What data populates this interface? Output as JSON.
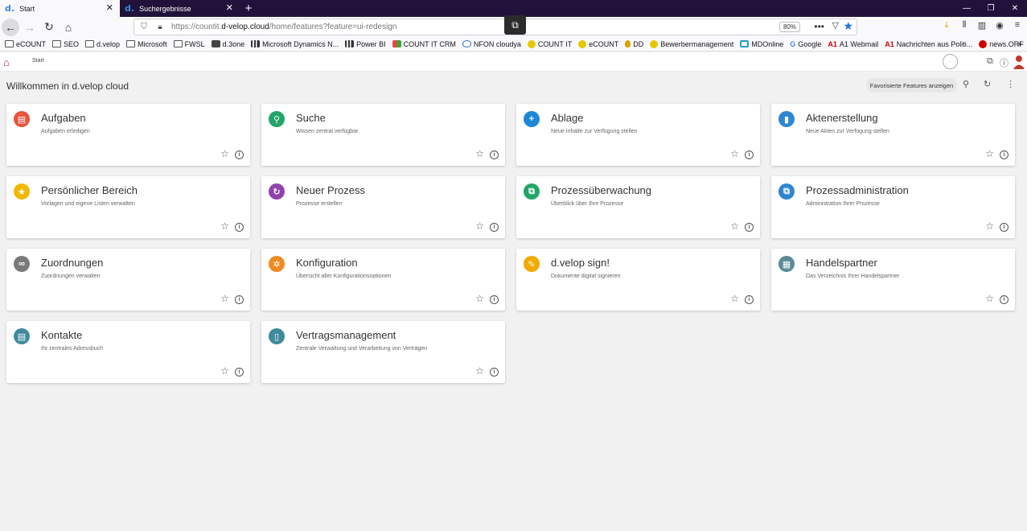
{
  "browser": {
    "tabs": [
      {
        "label": "Start",
        "favicon": "d."
      },
      {
        "label": "Suchergebnisse",
        "favicon": "d."
      }
    ],
    "url_prefix": "https://countit.",
    "url_domain": "d-velop.cloud",
    "url_path": "/home/features?feature=ui-redesign",
    "zoom": "80%"
  },
  "bookmarks": [
    {
      "label": "eCOUNT",
      "icon": "folder-icon"
    },
    {
      "label": "SEO",
      "icon": "folder-icon"
    },
    {
      "label": "d.velop",
      "icon": "folder-icon"
    },
    {
      "label": "Microsoft",
      "icon": "folder-icon"
    },
    {
      "label": "FWSL",
      "icon": "folder-icon"
    },
    {
      "label": "d.3one",
      "icon": "square-icon"
    },
    {
      "label": "Microsoft Dynamics N...",
      "icon": "dynamics-icon"
    },
    {
      "label": "Power BI",
      "icon": "powerbi-icon"
    },
    {
      "label": "COUNT IT CRM",
      "icon": "crm-icon"
    },
    {
      "label": "NFON cloudya",
      "icon": "nfon-icon"
    },
    {
      "label": "COUNT IT",
      "icon": "yellow-circle-icon"
    },
    {
      "label": "eCOUNT",
      "icon": "yellow-circle-icon"
    },
    {
      "label": "DD",
      "icon": "drop-icon"
    },
    {
      "label": "Bewerbermanagement",
      "icon": "yellow-circle-icon"
    },
    {
      "label": "MDOnline",
      "icon": "md-icon"
    },
    {
      "label": "Google",
      "icon": "google-icon"
    },
    {
      "label": "A1 Webmail",
      "icon": "a1-icon"
    },
    {
      "label": "Nachrichten aus Politi...",
      "icon": "a1-icon"
    },
    {
      "label": "news.ORF",
      "icon": "orf-icon"
    }
  ],
  "app": {
    "breadcrumb": "Start",
    "page_title": "Willkommen in d.velop cloud",
    "favorites_button": "Favorisierte Features anzeigen"
  },
  "features": [
    {
      "title": "Aufgaben",
      "subtitle": "Aufgaben erledigen",
      "icon": "clipboard-icon",
      "color": "#e8533b",
      "glyph": "▤"
    },
    {
      "title": "Suche",
      "subtitle": "Wissen zentral verfügbar",
      "icon": "search-icon",
      "color": "#23a56a",
      "glyph": "⚲"
    },
    {
      "title": "Ablage",
      "subtitle": "Neue Inhalte zur Verfügung stellen",
      "icon": "plus-icon",
      "color": "#1e88d6",
      "glyph": "+"
    },
    {
      "title": "Aktenerstellung",
      "subtitle": "Neue Akten zur Verfügung stellen",
      "icon": "folder-create-icon",
      "color": "#2f86d0",
      "glyph": "▮"
    },
    {
      "title": "Persönlicher Bereich",
      "subtitle": "Vorlagen und eigene Listen verwalten",
      "icon": "star-icon",
      "color": "#f2b705",
      "glyph": "★"
    },
    {
      "title": "Neuer Prozess",
      "subtitle": "Prozesse erstellen",
      "icon": "process-icon",
      "color": "#8e44ad",
      "glyph": "↻"
    },
    {
      "title": "Prozessüberwachung",
      "subtitle": "Überblick über Ihre Prozesse",
      "icon": "monitoring-icon",
      "color": "#23a56a",
      "glyph": "⧉"
    },
    {
      "title": "Prozessadministration",
      "subtitle": "Administration Ihrer Prozesse",
      "icon": "admin-icon",
      "color": "#2f86d0",
      "glyph": "⧉"
    },
    {
      "title": "Zuordnungen",
      "subtitle": "Zuordnungen verwalten",
      "icon": "link-icon",
      "color": "#7a7a7a",
      "glyph": "∞"
    },
    {
      "title": "Konfiguration",
      "subtitle": "Übersicht aller Konfigurationsoptionen",
      "icon": "gear-icon",
      "color": "#ee8a24",
      "glyph": "✲"
    },
    {
      "title": "d.velop sign!",
      "subtitle": "Dokumente digital signieren",
      "icon": "pen-icon",
      "color": "#f2a900",
      "glyph": "✎"
    },
    {
      "title": "Handelspartner",
      "subtitle": "Das Verzeichnis Ihrer Handelspartner",
      "icon": "partner-icon",
      "color": "#5a8a96",
      "glyph": "▦"
    },
    {
      "title": "Kontakte",
      "subtitle": "Ihr zentrales Adressbuch",
      "icon": "contact-card-icon",
      "color": "#3f8a9c",
      "glyph": "▤"
    },
    {
      "title": "Vertragsmanagement",
      "subtitle": "Zentrale Verwaltung und Verarbeitung von Verträgen",
      "icon": "contract-icon",
      "color": "#3f8a9c",
      "glyph": "▯"
    }
  ]
}
